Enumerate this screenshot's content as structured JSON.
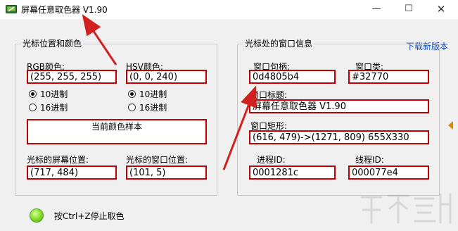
{
  "window": {
    "title": "屏幕任意取色器 V1.90",
    "controls": {
      "minimize": "—",
      "maximize": "☐",
      "close": "✕"
    }
  },
  "header": {
    "download_link": "下载新版本"
  },
  "color_panel": {
    "legend": "光标位置和颜色",
    "rgb": {
      "label": "RGB颜色:",
      "value": "(255, 255, 255)"
    },
    "hsv": {
      "label": "HSV颜色:",
      "value": "(0, 0, 240)"
    },
    "rgb_format": {
      "decimal": "10进制",
      "hex": "16进制",
      "selected": "10进制"
    },
    "hsv_format": {
      "decimal": "10进制",
      "hex": "16进制",
      "selected": "10进制"
    },
    "sample": {
      "label": "当前颜色样本",
      "color": "#ffffff"
    },
    "screen_pos": {
      "label": "光标的屏幕位置:",
      "value": "(717, 484)"
    },
    "window_pos": {
      "label": "光标的窗口位置:",
      "value": "(101, 5)"
    }
  },
  "window_panel": {
    "legend": "光标处的窗口信息",
    "handle": {
      "label": "窗口句柄:",
      "value": "0d4805b4"
    },
    "class": {
      "label": "窗口类:",
      "value": "#32770"
    },
    "title": {
      "label": "窗口标题:",
      "value": "屏幕任意取色器 V1.90"
    },
    "rect": {
      "label": "窗口矩形:",
      "value": "(616, 479)->(1271, 809) 655X330"
    },
    "process_id": {
      "label": "进程ID:",
      "value": "0001281c"
    },
    "thread_id": {
      "label": "线程ID:",
      "value": "000077e4"
    }
  },
  "footer": {
    "hint": "按Ctrl+Z停止取色",
    "status_color": "#86dd2b"
  },
  "icons": [
    "app-icon",
    "status-led-icon",
    "collapse-arrow-icon",
    "annotation-arrow"
  ],
  "colors": {
    "highlight_border": "#c00000",
    "link": "#1a4fb3",
    "annotation": "#d02020"
  }
}
